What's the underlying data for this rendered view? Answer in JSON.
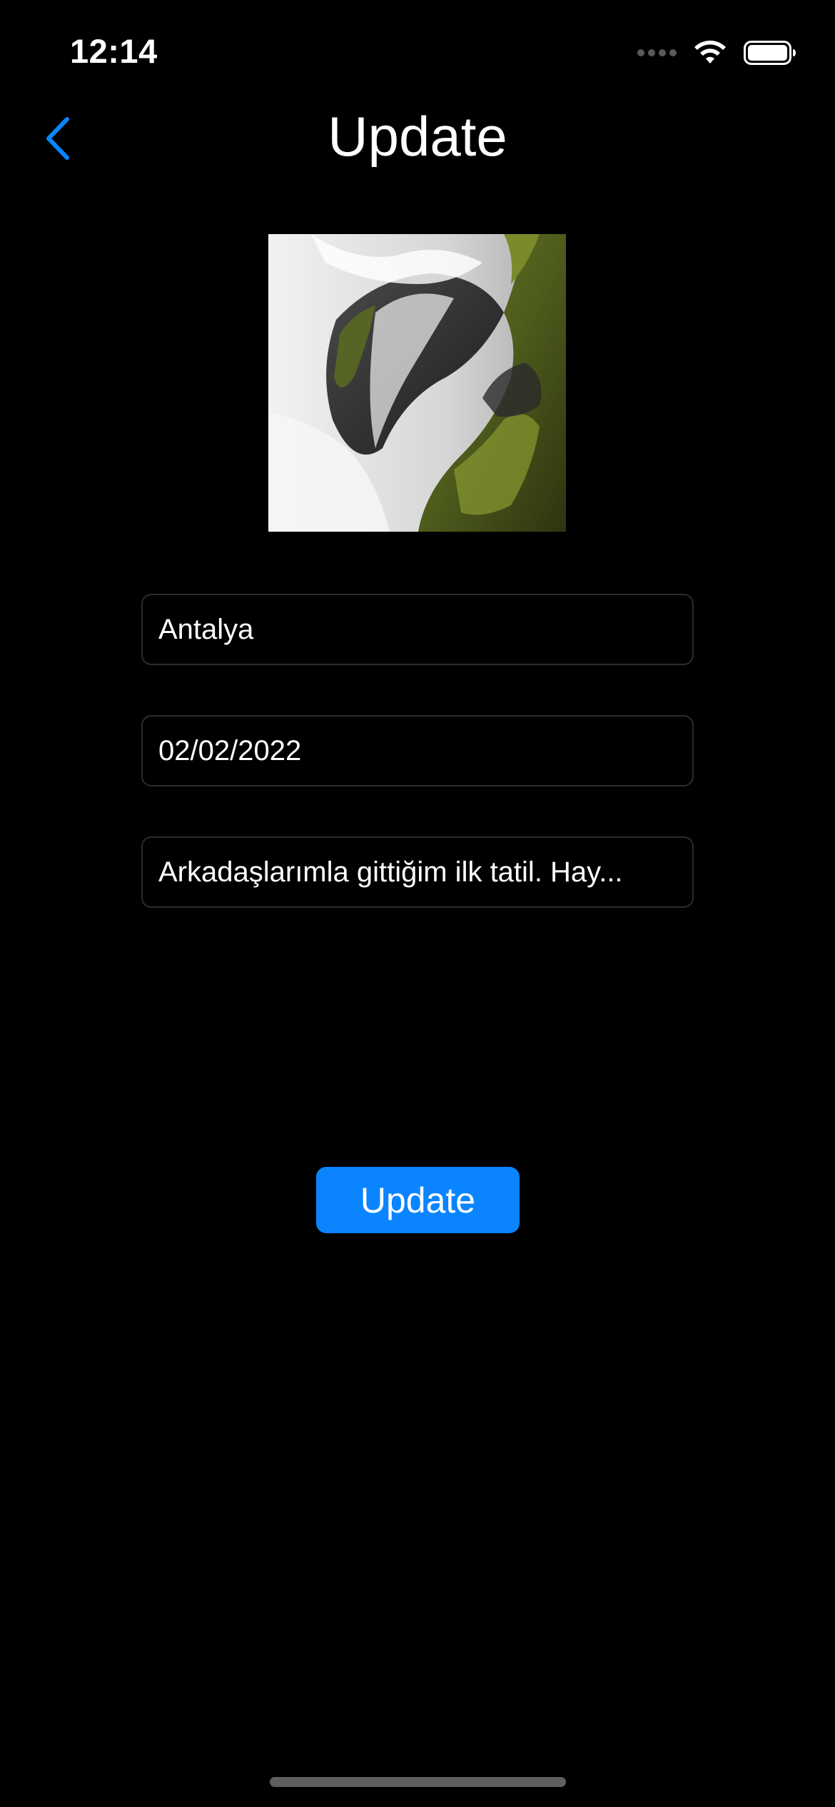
{
  "status_bar": {
    "time": "12:14",
    "icons": [
      "cellular-dots-icon",
      "wifi-icon",
      "battery-icon"
    ]
  },
  "nav": {
    "back_icon": "chevron-left-icon",
    "title": "Update"
  },
  "photo": {
    "subject": "waterfall over mossy rocks"
  },
  "form": {
    "place": "Antalya",
    "date": "02/02/2022",
    "description": "Arkadaşlarımla gittiğim ilk tatil. Hay..."
  },
  "actions": {
    "update_label": "Update"
  },
  "colors": {
    "background": "#000000",
    "accent": "#0a84ff",
    "field_border": "#2c2c2e",
    "text": "#ffffff"
  }
}
